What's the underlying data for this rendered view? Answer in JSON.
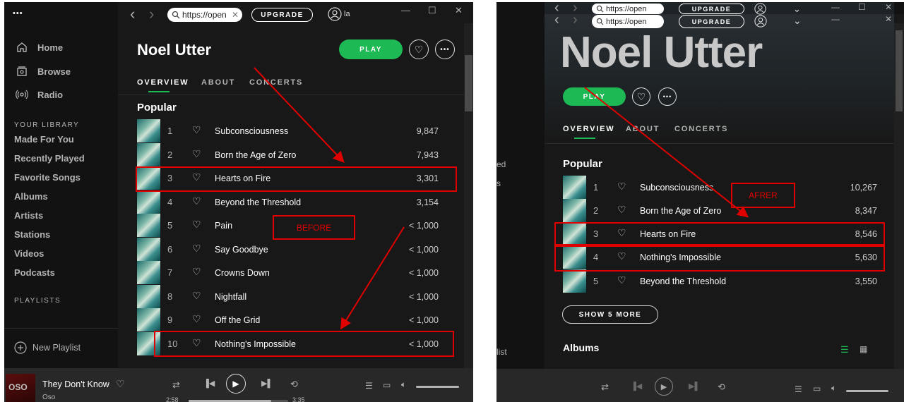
{
  "window": {
    "minimize": "—",
    "maximize": "☐",
    "close": "✕"
  },
  "topbar": {
    "back": "‹",
    "forward": "›",
    "url": "https://open",
    "url_clear": "✕",
    "upgrade": "UPGRADE",
    "user_initial": "la"
  },
  "sidebar": {
    "dots": "•••",
    "nav": [
      {
        "label": "Home",
        "icon": "home-icon"
      },
      {
        "label": "Browse",
        "icon": "browse-icon"
      },
      {
        "label": "Radio",
        "icon": "radio-icon"
      }
    ],
    "library_header": "YOUR LIBRARY",
    "library": [
      "Made For You",
      "Recently Played",
      "Favorite Songs",
      "Albums",
      "Artists",
      "Stations",
      "Videos",
      "Podcasts"
    ],
    "playlists_header": "PLAYLISTS",
    "new_playlist": "New Playlist"
  },
  "artist": {
    "name": "Noel Utter",
    "play": "PLAY",
    "tabs": [
      "OVERVIEW",
      "ABOUT",
      "CONCERTS"
    ],
    "popular_heading": "Popular"
  },
  "before": {
    "label": "BEFORE",
    "tracks": [
      {
        "num": "1",
        "title": "Subconsciousness",
        "plays": "9,847"
      },
      {
        "num": "2",
        "title": "Born the Age of Zero",
        "plays": "7,943"
      },
      {
        "num": "3",
        "title": "Hearts on Fire",
        "plays": "3,301"
      },
      {
        "num": "4",
        "title": "Beyond the Threshold",
        "plays": "3,154"
      },
      {
        "num": "5",
        "title": "Pain",
        "plays": "< 1,000"
      },
      {
        "num": "6",
        "title": "Say Goodbye",
        "plays": "< 1,000"
      },
      {
        "num": "7",
        "title": "Crowns Down",
        "plays": "< 1,000"
      },
      {
        "num": "8",
        "title": "Nightfall",
        "plays": "< 1,000"
      },
      {
        "num": "9",
        "title": "Off the Grid",
        "plays": "< 1,000"
      },
      {
        "num": "10",
        "title": "Nothing's Impossible",
        "plays": "< 1,000"
      }
    ]
  },
  "after": {
    "label": "AFRER",
    "tracks": [
      {
        "num": "1",
        "title": "Subconsciousness",
        "plays": "10,267"
      },
      {
        "num": "2",
        "title": "Born the Age of Zero",
        "plays": "8,347"
      },
      {
        "num": "3",
        "title": "Hearts on Fire",
        "plays": "8,546"
      },
      {
        "num": "4",
        "title": "Nothing's Impossible",
        "plays": "5,630"
      },
      {
        "num": "5",
        "title": "Beyond the Threshold",
        "plays": "3,550"
      }
    ],
    "show_more": "SHOW 5 MORE",
    "albums_heading": "Albums",
    "side_partial_1": "ed",
    "side_partial_2": "s",
    "side_partial_3": "list"
  },
  "player": {
    "track": "They Don't Know",
    "artist": "Oso",
    "album_art_text": "OSO",
    "elapsed": "2:58",
    "duration": "3:35",
    "progress": 0.83,
    "volume": 1.0
  },
  "colors": {
    "green": "#1db954",
    "annotation_red": "#e00000",
    "bg": "#181818",
    "sidebar": "#121212",
    "player": "#282828"
  }
}
